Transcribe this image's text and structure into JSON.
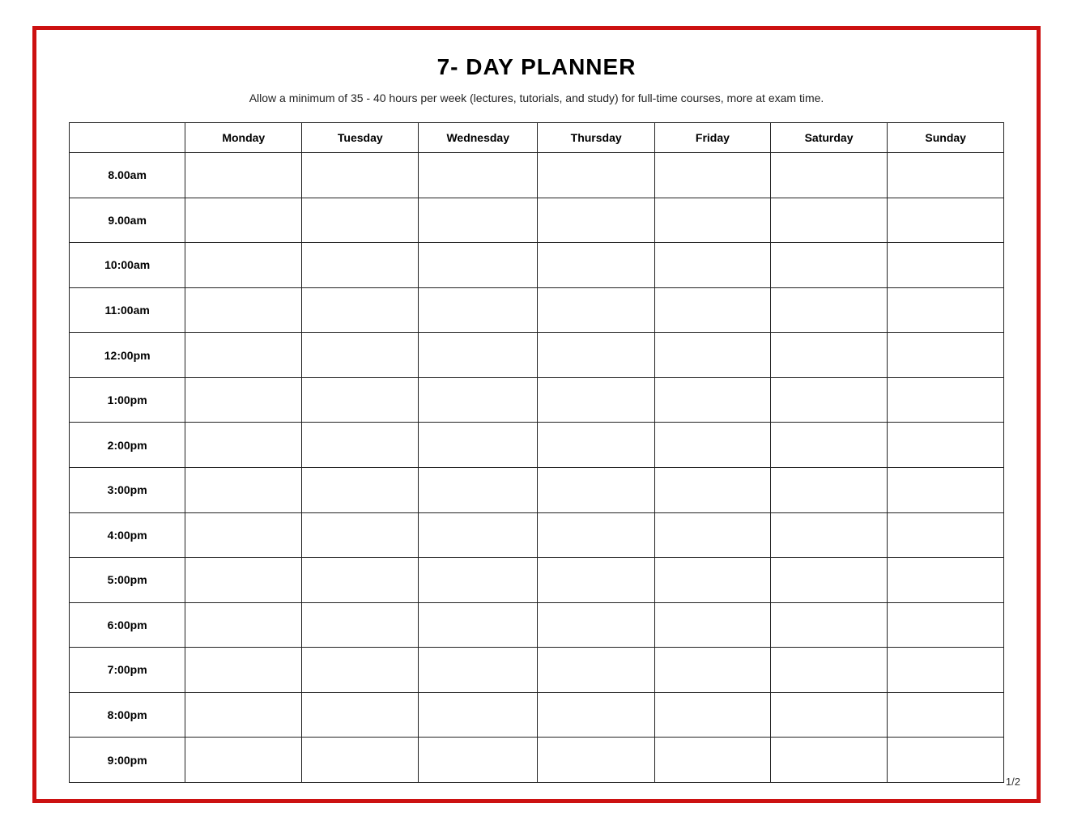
{
  "page": {
    "title": "7- DAY PLANNER",
    "subtitle": "Allow a minimum of 35 - 40 hours per week (lectures, tutorials, and study) for full-time courses, more at exam time.",
    "page_number": "1/2"
  },
  "table": {
    "columns": [
      "",
      "Monday",
      "Tuesday",
      "Wednesday",
      "Thursday",
      "Friday",
      "Saturday",
      "Sunday"
    ],
    "rows": [
      "8.00am",
      "9.00am",
      "10:00am",
      "11:00am",
      "12:00pm",
      "1:00pm",
      "2:00pm",
      "3:00pm",
      "4:00pm",
      "5:00pm",
      "6:00pm",
      "7:00pm",
      "8:00pm",
      "9:00pm"
    ]
  }
}
